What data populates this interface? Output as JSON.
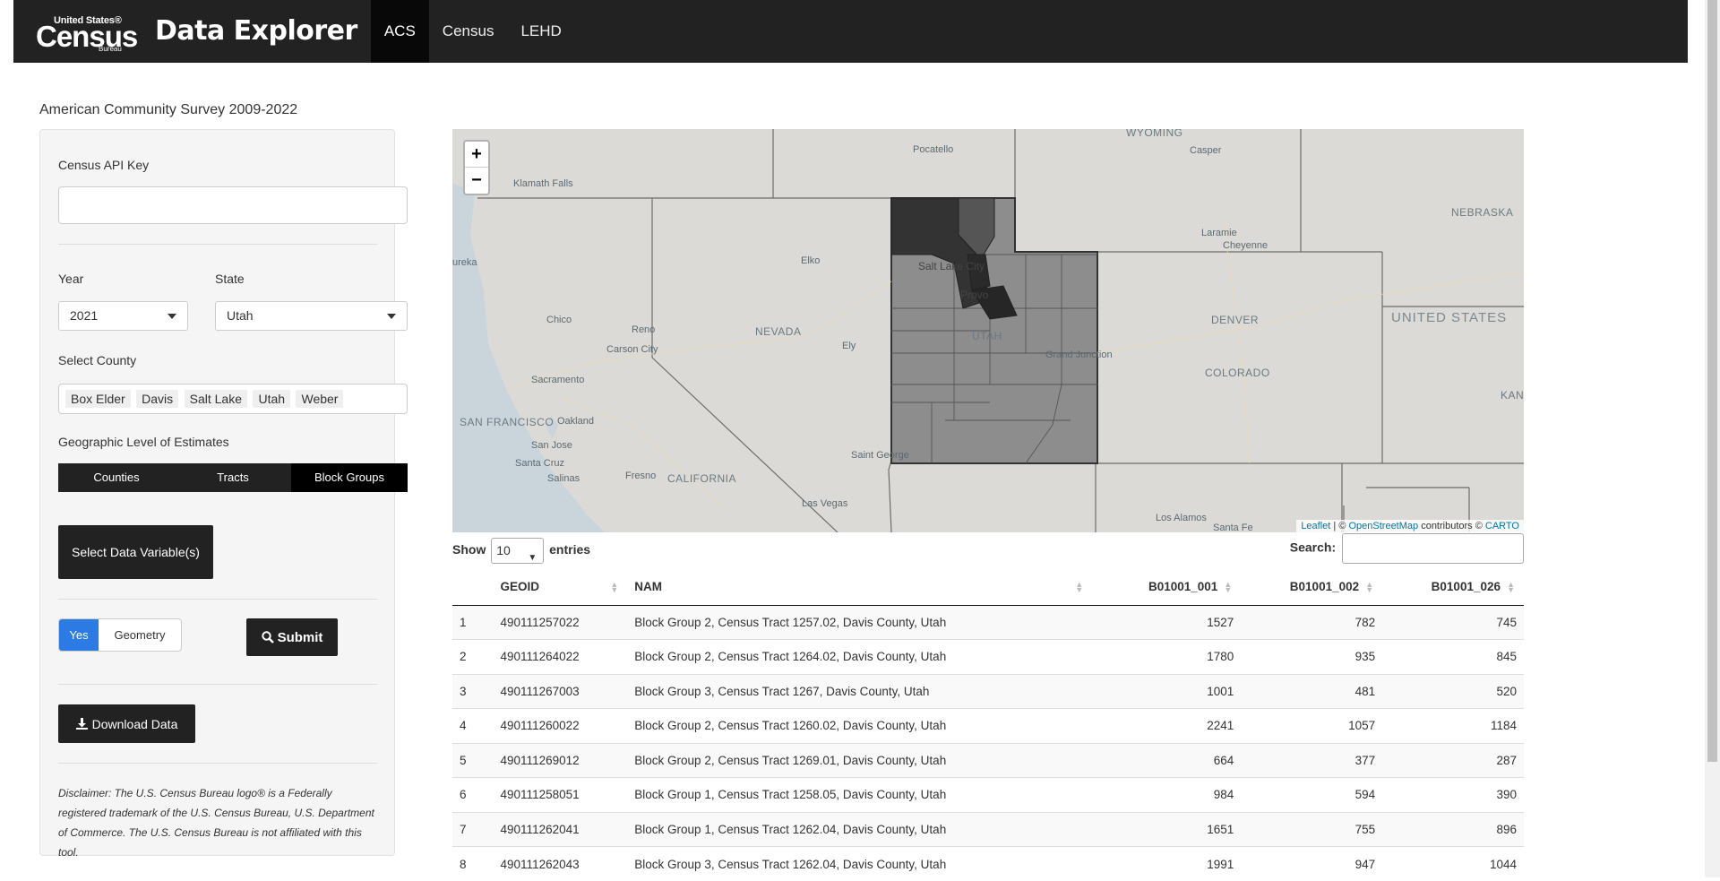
{
  "nav": {
    "logo_line1": "United States®",
    "logo_line2": "Census",
    "logo_line3": "Bureau",
    "title": "Data Explorer",
    "tabs": [
      "ACS",
      "Census",
      "LEHD"
    ]
  },
  "page_title": "American Community Survey 2009-2022",
  "sidebar": {
    "api_key_label": "Census API Key",
    "api_key_value": "",
    "year_label": "Year",
    "year_value": "2021",
    "state_label": "State",
    "state_value": "Utah",
    "county_label": "Select County",
    "counties": [
      "Box Elder",
      "Davis",
      "Salt Lake",
      "Utah",
      "Weber"
    ],
    "geo_label": "Geographic Level of Estimates",
    "geo_levels": [
      "Counties",
      "Tracts",
      "Block Groups"
    ],
    "geo_selected": "Block Groups",
    "select_vars_button": "Select Data Variable(s)",
    "geometry_on": "Yes",
    "geometry_label": "Geometry",
    "submit_button": "Submit",
    "download_button": "Download Data",
    "disclaimer": "Disclaimer: The U.S. Census Bureau logo® is a Federally registered trademark of the U.S. Census Bureau, U.S. Department of Commerce. The U.S. Census Bureau is not affiliated with this tool."
  },
  "map": {
    "zoom_in": "+",
    "zoom_out": "−",
    "attribution_leaflet": "Leaflet",
    "attribution_mid": " | © ",
    "attribution_osm": "OpenStreetMap",
    "attribution_contrib": " contributors © ",
    "attribution_carto": "CARTO",
    "labels": {
      "wyoming": "WYOMING",
      "pocatello": "Pocatello",
      "casper": "Casper",
      "klamath": "Klamath Falls",
      "nebraska": "NEBRASKA",
      "laramie": "Laramie",
      "cheyenne": "Cheyenne",
      "eureka": "ureka",
      "elko": "Elko",
      "slc": "Salt Lake City",
      "provo": "Provo",
      "denver": "DENVER",
      "united_states": "UNITED STATES",
      "chico": "Chico",
      "reno": "Reno",
      "nevada": "NEVADA",
      "carson": "Carson City",
      "ely": "Ely",
      "utah": "UTAH",
      "grand_junction": "Grand Junction",
      "colorado": "COLORADO",
      "kan": "KAN",
      "sacramento": "Sacramento",
      "sf": "SAN FRANCISCO",
      "oakland": "Oakland",
      "san_jose": "San Jose",
      "santa_cruz": "Santa Cruz",
      "salinas": "Salinas",
      "fresno": "Fresno",
      "california": "CALIFORNIA",
      "st_george": "Saint George",
      "las_vegas": "Las Vegas",
      "los_alamos": "Los Alamos",
      "santa_fe": "Santa Fe"
    }
  },
  "table": {
    "show_label": "Show",
    "length_value": "10",
    "entries_label": "entries",
    "search_label": "Search:",
    "search_value": "",
    "columns": [
      "",
      "GEOID",
      "NAM",
      "B01001_001",
      "B01001_002",
      "B01001_026"
    ],
    "rows": [
      [
        "1",
        "490111257022",
        "Block Group 2, Census Tract 1257.02, Davis County, Utah",
        "1527",
        "782",
        "745"
      ],
      [
        "2",
        "490111264022",
        "Block Group 2, Census Tract 1264.02, Davis County, Utah",
        "1780",
        "935",
        "845"
      ],
      [
        "3",
        "490111267003",
        "Block Group 3, Census Tract 1267, Davis County, Utah",
        "1001",
        "481",
        "520"
      ],
      [
        "4",
        "490111260022",
        "Block Group 2, Census Tract 1260.02, Davis County, Utah",
        "2241",
        "1057",
        "1184"
      ],
      [
        "5",
        "490111269012",
        "Block Group 2, Census Tract 1269.01, Davis County, Utah",
        "664",
        "377",
        "287"
      ],
      [
        "6",
        "490111258051",
        "Block Group 1, Census Tract 1258.05, Davis County, Utah",
        "984",
        "594",
        "390"
      ],
      [
        "7",
        "490111262041",
        "Block Group 1, Census Tract 1262.04, Davis County, Utah",
        "1651",
        "755",
        "896"
      ],
      [
        "8",
        "490111262043",
        "Block Group 3, Census Tract 1262.04, Davis County, Utah",
        "1991",
        "947",
        "1044"
      ]
    ]
  }
}
